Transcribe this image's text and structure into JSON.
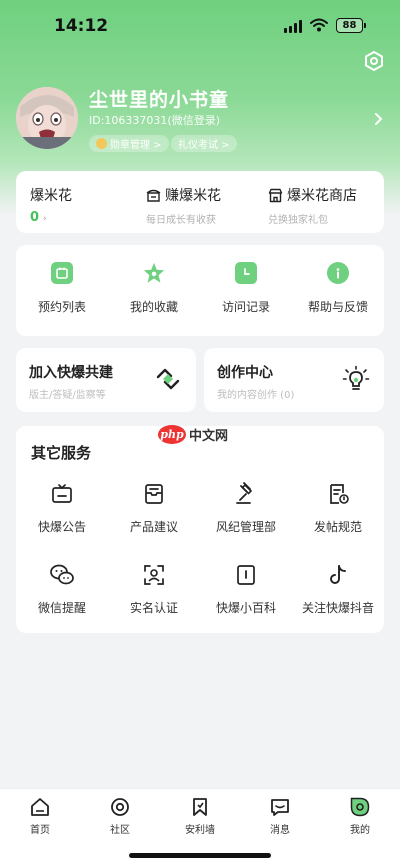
{
  "status_bar": {
    "time": "14:12",
    "battery": "88"
  },
  "profile": {
    "username": "尘世里的小书童",
    "user_id": "ID:106337031(微信登录)",
    "tags": [
      "勋章管理 >",
      "礼仪考试 >"
    ]
  },
  "popcorn": {
    "title": "爆米花",
    "count": "0",
    "earn_title": "赚爆米花",
    "earn_sub": "每日成长有收获",
    "shop_title": "爆米花商店",
    "shop_sub": "兑换独家礼包"
  },
  "quick_actions": [
    {
      "label": "预约列表",
      "icon": "calendar-icon"
    },
    {
      "label": "我的收藏",
      "icon": "star-icon"
    },
    {
      "label": "访问记录",
      "icon": "clock-icon"
    },
    {
      "label": "帮助与反馈",
      "icon": "info-icon"
    }
  ],
  "join_card": {
    "title": "加入快爆共建",
    "subtitle": "版主/答疑/监察等"
  },
  "create_card": {
    "title": "创作中心",
    "subtitle": "我的内容创作 (0)"
  },
  "services": {
    "title": "其它服务",
    "items": [
      {
        "label": "快爆公告",
        "icon": "announcement-icon"
      },
      {
        "label": "产品建议",
        "icon": "suggestion-icon"
      },
      {
        "label": "风纪管理部",
        "icon": "gavel-icon"
      },
      {
        "label": "发帖规范",
        "icon": "rules-icon"
      },
      {
        "label": "微信提醒",
        "icon": "wechat-icon"
      },
      {
        "label": "实名认证",
        "icon": "face-id-icon"
      },
      {
        "label": "快爆小百科",
        "icon": "encyclopedia-icon"
      },
      {
        "label": "关注快爆抖音",
        "icon": "douyin-icon"
      }
    ]
  },
  "watermark": {
    "logo": "php",
    "text": "中文网"
  },
  "tabbar": [
    {
      "label": "首页",
      "icon": "home-icon"
    },
    {
      "label": "社区",
      "icon": "community-icon"
    },
    {
      "label": "安利墙",
      "icon": "bookmark-icon"
    },
    {
      "label": "消息",
      "icon": "message-icon"
    },
    {
      "label": "我的",
      "icon": "profile-icon",
      "active": true
    }
  ],
  "colors": {
    "brand_green": "#6fd07f",
    "accent_green": "#45c05a",
    "background": "#f2f3f5"
  }
}
